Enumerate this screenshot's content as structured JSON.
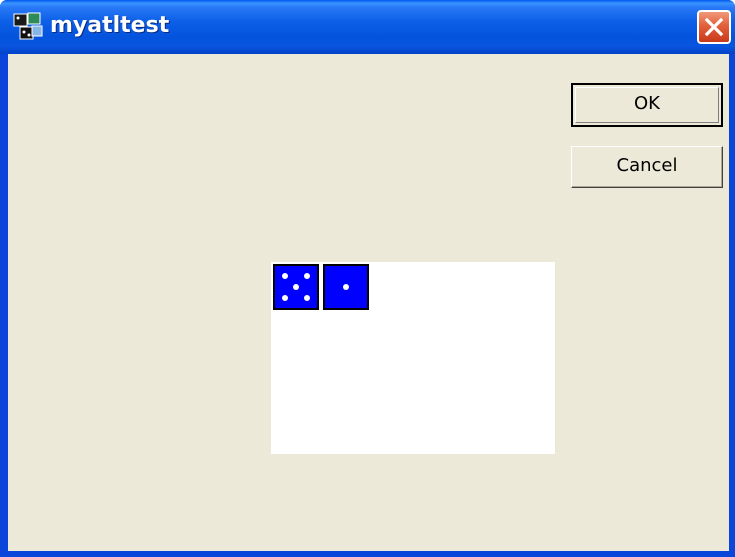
{
  "window": {
    "title": "myatltest",
    "app_icon": "atl-project-icon",
    "close_icon": "close-x-icon",
    "close_color": "#e04a23",
    "titlebar_color": "#0a55e0",
    "client_color": "#ece9d8"
  },
  "buttons": {
    "ok_label": "OK",
    "cancel_label": "Cancel"
  },
  "dice_control": {
    "background": "#ffffff",
    "die_color": "#0000ff",
    "dice": [
      {
        "value": 5
      },
      {
        "value": 1
      }
    ]
  }
}
